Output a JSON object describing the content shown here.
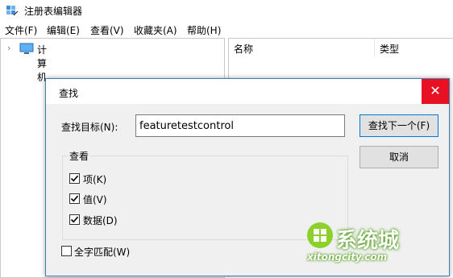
{
  "window": {
    "title": "注册表编辑器"
  },
  "menu": [
    "文件(F)",
    "编辑(E)",
    "查看(V)",
    "收藏夹(A)",
    "帮助(H)"
  ],
  "tree": {
    "root_label": "计算机"
  },
  "list_headers": [
    "名称",
    "类型"
  ],
  "dialog": {
    "title": "查找",
    "find_label": "查找目标(N):",
    "find_value": "featuretestcontrol",
    "find_next_label": "查找下一个(F)",
    "cancel_label": "取消",
    "look_at_group": "查看",
    "options": [
      {
        "label": "项(K)",
        "checked": true
      },
      {
        "label": "值(V)",
        "checked": true
      },
      {
        "label": "数据(D)",
        "checked": true
      }
    ],
    "whole_word": {
      "label": "全字匹配(W)",
      "checked": false
    },
    "close_glyph": "✕"
  },
  "watermark": {
    "brand": "系统城",
    "url": "xitongcity.com"
  },
  "colors": {
    "close_red": "#e81123",
    "dialog_bg": "#f0f0f0",
    "focus_blue": "#0078d7"
  }
}
